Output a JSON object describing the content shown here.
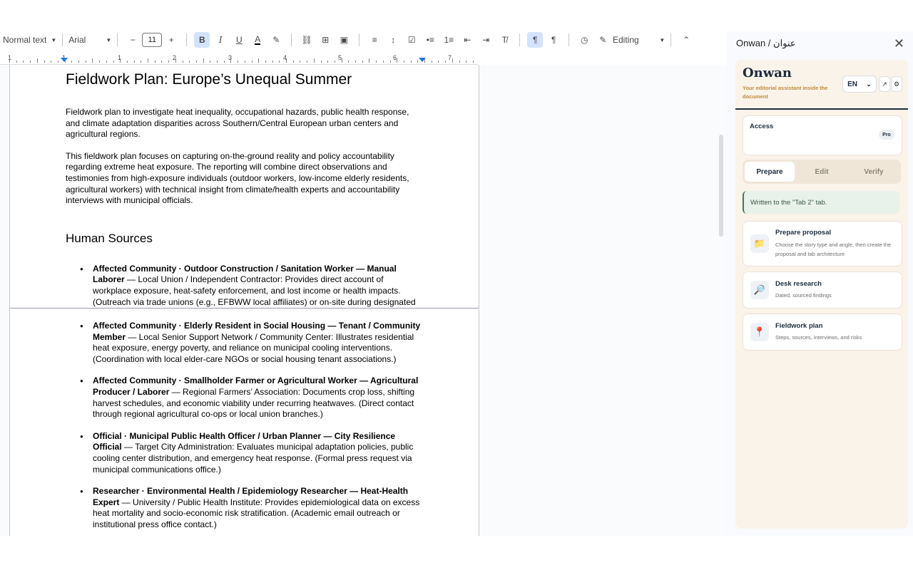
{
  "toolbar": {
    "style": "Normal text",
    "font": "Arial",
    "size": "11",
    "mode": "Editing"
  },
  "ruler": {
    "numbers": [
      "1",
      "1",
      "1",
      "2",
      "3",
      "4",
      "5",
      "6",
      "7"
    ]
  },
  "document": {
    "title": "Fieldwork Plan: Europe’s Unequal Summer",
    "intro": "Fieldwork plan to investigate heat inequality, occupational hazards, public health response, and climate adaptation disparities across Southern/Central European urban centers and agricultural regions.",
    "focus": "This fieldwork plan focuses on capturing on-the-ground reality and policy accountability regarding extreme heat exposure. The reporting will combine direct observations and testimonies from high-exposure individuals (outdoor workers, low-income elderly residents, agricultural workers) with technical insight from climate/health experts and accountability interviews with municipal officials.",
    "section_heading": "Human Sources",
    "sources": [
      {
        "bold": "Affected Community · Outdoor Construction / Sanitation Worker — Manual Laborer",
        "text": " — Local Union / Independent Contractor: Provides direct account of workplace exposure, heat-safety enforcement, and lost income or health impacts. (Outreach via trade unions (e.g., EFBWW local affiliates) or on-site during designated rest breaks.)"
      },
      {
        "bold": "Affected Community · Elderly Resident in Social Housing — Tenant / Community Member",
        "text": " — Local Senior Support Network / Community Center: Illustrates residential heat exposure, energy poverty, and reliance on municipal cooling interventions. (Coordination with local elder-care NGOs or social housing tenant associations.)"
      },
      {
        "bold": "Affected Community · Smallholder Farmer or Agricultural Worker — Agricultural Producer / Laborer",
        "text": " — Regional Farmers’ Association: Documents crop loss, shifting harvest schedules, and economic viability under recurring heatwaves. (Direct contact through regional agricultural co-ops or local union branches.)"
      },
      {
        "bold": "Official · Municipal Public Health Officer / Urban Planner — City Resilience Official",
        "text": " — Target City Administration: Evaluates municipal adaptation policies, public cooling center distribution, and emergency heat response. (Formal press request via municipal communications office.)"
      },
      {
        "bold": "Researcher · Environmental Health / Epidemiology Researcher — Heat-Health Expert",
        "text": " — University / Public Health Institute: Provides epidemiological data on excess heat mortality and socio-economic risk stratification. (Academic email outreach or institutional press office contact.)"
      }
    ]
  },
  "panel": {
    "title": "Onwan / عنوان",
    "brand": "Onwan",
    "tagline": "Your editorial assistant inside the document",
    "language": "EN",
    "access_label": "Access",
    "plan_badge": "Pro",
    "tabs": [
      "Prepare",
      "Edit",
      "Verify"
    ],
    "active_tab": "Prepare",
    "notice": "Written to the \"Tab 2\" tab.",
    "actions": [
      {
        "title": "Prepare proposal",
        "desc": "Choose the story type and angle, then create the proposal and tab architecture",
        "icon": "folder-icon"
      },
      {
        "title": "Desk research",
        "desc": "Dated, sourced findings",
        "icon": "magnifier-icon"
      },
      {
        "title": "Fieldwork plan",
        "desc": "Steps, sources, interviews, and risks",
        "icon": "pin-icon"
      }
    ]
  },
  "colors": {
    "accent": "#1c2c3c",
    "tagline": "#c08a3a",
    "panel_bg": "#faf3ea",
    "notice_bg": "#e8f1ea"
  }
}
